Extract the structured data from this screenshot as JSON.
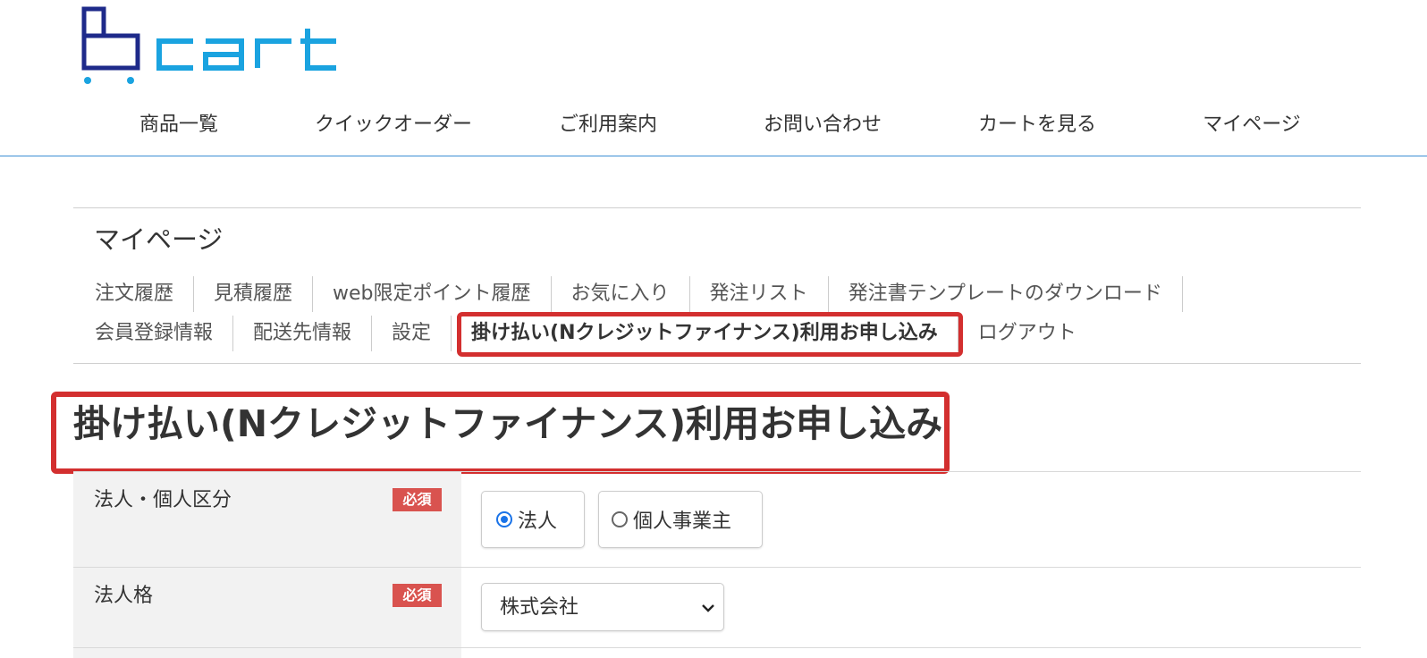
{
  "header": {
    "logo_text": "cart",
    "nav": [
      {
        "label": "商品一覧"
      },
      {
        "label": "クイックオーダー"
      },
      {
        "label": "ご利用案内"
      },
      {
        "label": "お問い合わせ"
      },
      {
        "label": "カートを見る"
      },
      {
        "label": "マイページ"
      }
    ]
  },
  "mypage": {
    "title": "マイページ",
    "subnav_row1": [
      {
        "label": "注文履歴"
      },
      {
        "label": "見積履歴"
      },
      {
        "label": "web限定ポイント履歴"
      },
      {
        "label": "お気に入り"
      },
      {
        "label": "発注リスト"
      },
      {
        "label": "発注書テンプレートのダウンロード"
      }
    ],
    "subnav_row2": [
      {
        "label": "会員登録情報"
      },
      {
        "label": "配送先情報"
      },
      {
        "label": "設定"
      },
      {
        "label": "掛け払い(Nクレジットファイナンス)利用お申し込み",
        "active": true
      },
      {
        "label": "ログアウト"
      }
    ]
  },
  "page": {
    "heading": "掛け払い(Nクレジットファイナンス)利用お申し込み"
  },
  "form": {
    "required_label": "必須",
    "entity_type": {
      "label": "法人・個人区分",
      "options": [
        {
          "label": "法人",
          "checked": true
        },
        {
          "label": "個人事業主",
          "checked": false
        }
      ]
    },
    "corporate_type": {
      "label": "法人格",
      "value": "株式会社"
    }
  },
  "colors": {
    "accent_blue": "#1a73e8",
    "header_line": "#3b8fd4",
    "highlight_red": "#d32f2f",
    "required_badge": "#d9534f",
    "logo_navy": "#1e2a8a",
    "logo_cyan": "#1aa3e0"
  }
}
